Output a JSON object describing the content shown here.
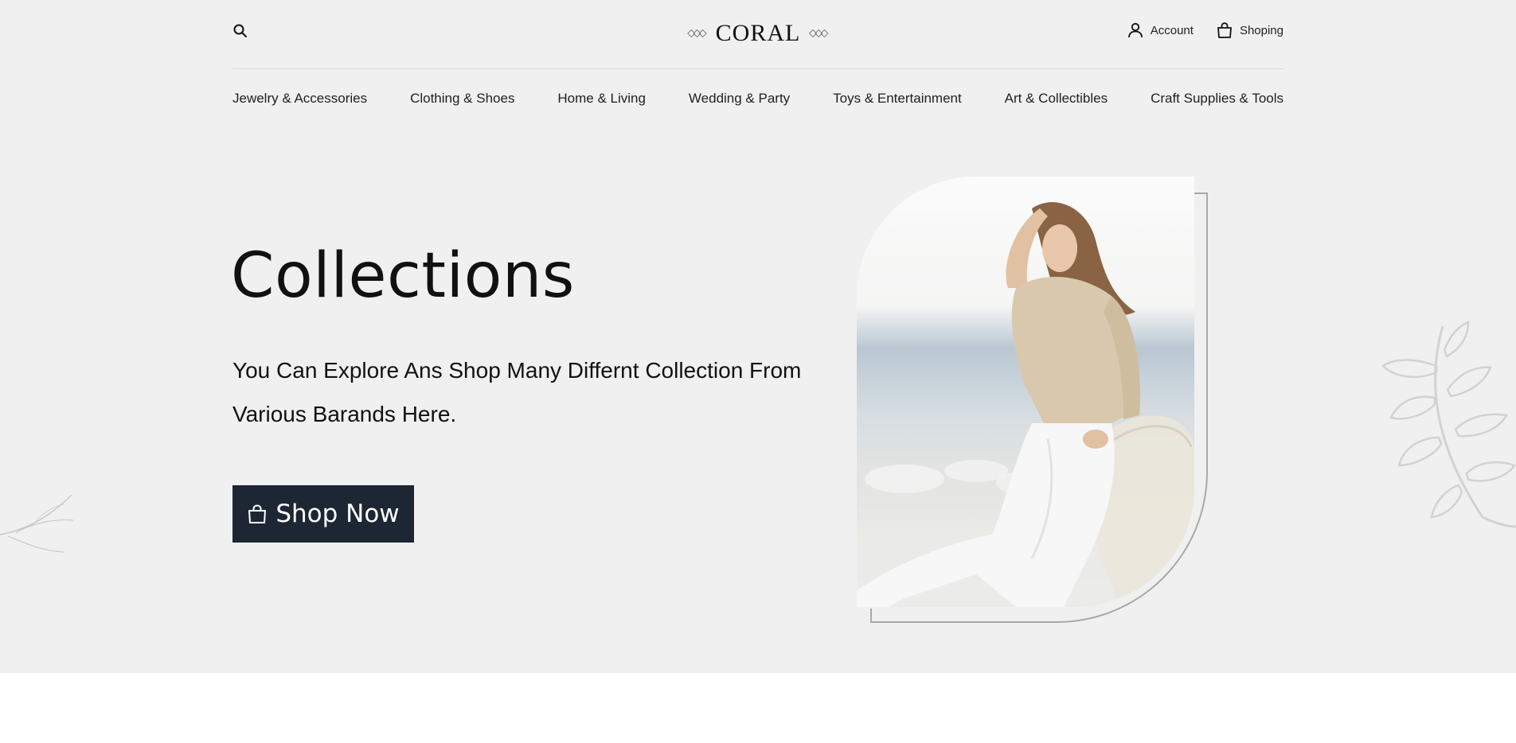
{
  "header": {
    "logo_text": "CORAL",
    "account_label": "Account",
    "cart_label": "Shoping"
  },
  "nav": {
    "items": [
      "Jewelry & Accessories",
      "Clothing & Shoes",
      "Home & Living",
      "Wedding & Party",
      "Toys & Entertainment",
      "Art & Collectibles",
      "Craft Supplies & Tools"
    ]
  },
  "hero": {
    "title": "Collections",
    "subtitle": "You Can Explore Ans Shop Many Differnt Collection From Various Barands Here.",
    "button_label": "Shop Now"
  },
  "icons": {
    "search": "search-icon",
    "account": "user-icon",
    "cart": "shopping-bag-icon",
    "button": "shopping-bag-icon"
  },
  "colors": {
    "background": "#f0f0f0",
    "button_bg": "#1d2733",
    "button_text": "#ffffff",
    "text": "#111111",
    "outline": "#a9a9a9"
  }
}
